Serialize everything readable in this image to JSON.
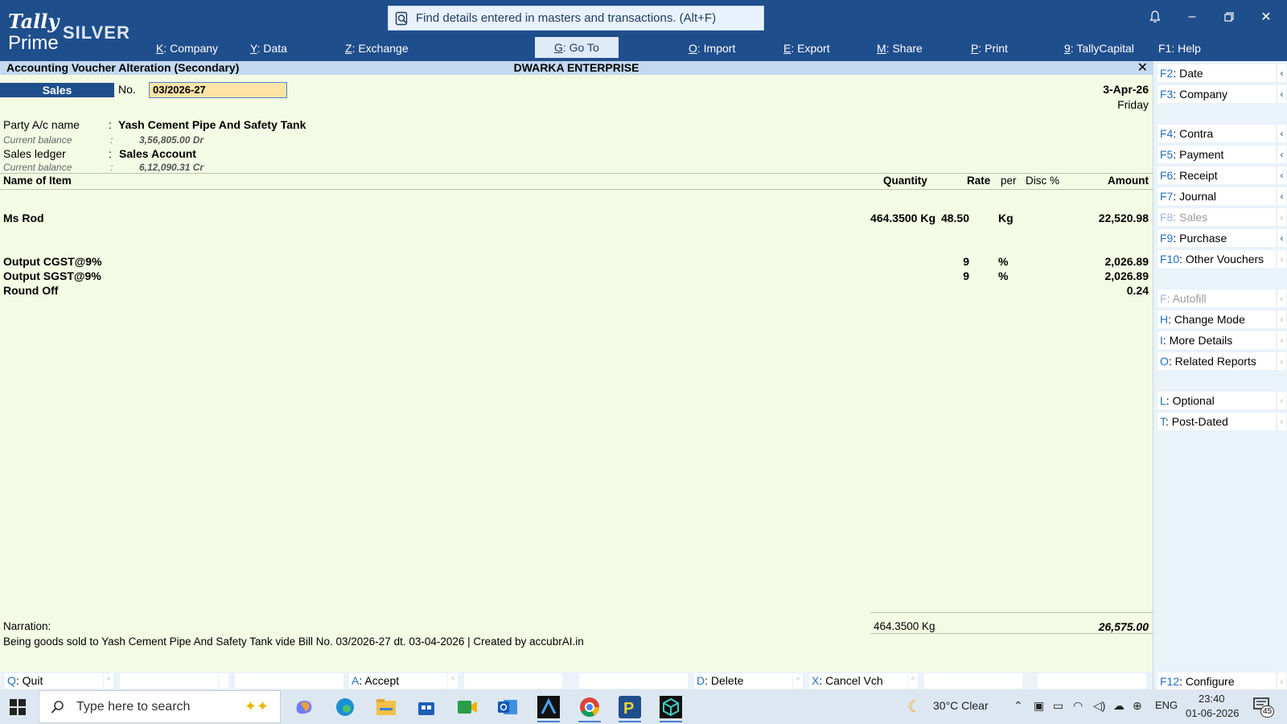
{
  "app": {
    "logo_line1": "Tally",
    "logo_line2": "Prime",
    "edition": "SILVER"
  },
  "search": {
    "text": "Find details entered in masters and transactions. (Alt+F)"
  },
  "menu": [
    {
      "key": "K",
      "label": "Company"
    },
    {
      "key": "Y",
      "label": "Data"
    },
    {
      "key": "Z",
      "label": "Exchange"
    },
    {
      "key": "G",
      "label": "Go To"
    },
    {
      "key": "O",
      "label": "Import"
    },
    {
      "key": "E",
      "label": "Export"
    },
    {
      "key": "M",
      "label": "Share"
    },
    {
      "key": "P",
      "label": "Print"
    },
    {
      "key": "9",
      "label": "TallyCapital"
    },
    {
      "key": "F1",
      "label": "Help"
    }
  ],
  "screen": {
    "title": "Accounting Voucher Alteration (Secondary)",
    "company": "DWARKA ENTERPRISE",
    "close": "✕"
  },
  "voucher": {
    "type": "Sales",
    "no_label": "No.",
    "number": "03/2026-27",
    "date": "3-Apr-26",
    "day": "Friday",
    "party_label": "Party A/c name",
    "party_name": "Yash Cement Pipe And Safety Tank",
    "party_balance_label": "Current balance",
    "party_balance": "3,56,805.00 Dr",
    "ledger_label": "Sales ledger",
    "ledger_name": "Sales Account",
    "ledger_balance_label": "Current balance",
    "ledger_balance": "6,12,090.31 Cr",
    "colon": ":"
  },
  "columns": {
    "item": "Name of Item",
    "quantity": "Quantity",
    "rate": "Rate",
    "per": "per",
    "disc": "Disc %",
    "amount": "Amount"
  },
  "items": [
    {
      "name": "Ms Rod",
      "quantity": "464.3500 Kg",
      "rate": "48.50",
      "per": "Kg",
      "amount": "22,520.98"
    }
  ],
  "ledgers": [
    {
      "name": "Output CGST@9%",
      "rate": "9",
      "per": "%",
      "amount": "2,026.89"
    },
    {
      "name": "Output SGST@9%",
      "rate": "9",
      "per": "%",
      "amount": "2,026.89"
    },
    {
      "name": "Round Off",
      "rate": "",
      "per": "",
      "amount": "0.24"
    }
  ],
  "footer": {
    "narration_label": "Narration:",
    "narration": "Being goods sold to Yash Cement Pipe And Safety Tank vide Bill No. 03/2026-27 dt. 03-04-2026 | Created by accubrAI.in",
    "total_qty": "464.3500 Kg",
    "total_amount": "26,575.00"
  },
  "right_panel": [
    {
      "key": "F2",
      "label": "Date",
      "enabled": true
    },
    {
      "key": "F3",
      "label": "Company",
      "enabled": true
    },
    {
      "key": "F4",
      "label": "Contra",
      "enabled": true
    },
    {
      "key": "F5",
      "label": "Payment",
      "enabled": true
    },
    {
      "key": "F6",
      "label": "Receipt",
      "enabled": true
    },
    {
      "key": "F7",
      "label": "Journal",
      "enabled": true
    },
    {
      "key": "F8",
      "label": "Sales",
      "enabled": false
    },
    {
      "key": "F9",
      "label": "Purchase",
      "enabled": true
    },
    {
      "key": "F10",
      "label": "Other Vouchers",
      "enabled": true
    },
    {
      "key": "F",
      "label": "Autofill",
      "enabled": false
    },
    {
      "key": "H",
      "label": "Change Mode",
      "enabled": true
    },
    {
      "key": "I",
      "label": "More Details",
      "enabled": true
    },
    {
      "key": "O",
      "label": "Related Reports",
      "enabled": true
    },
    {
      "key": "L",
      "label": "Optional",
      "enabled": true
    },
    {
      "key": "T",
      "label": "Post-Dated",
      "enabled": true
    },
    {
      "key": "F12",
      "label": "Configure",
      "enabled": true
    }
  ],
  "action_bar": [
    {
      "key": "Q",
      "label": "Quit"
    },
    {
      "key": "A",
      "label": "Accept"
    },
    {
      "key": "D",
      "label": "Delete"
    },
    {
      "key": "X",
      "label": "Cancel Vch"
    }
  ],
  "taskbar": {
    "search_placeholder": "Type here to search",
    "weather": "30°C  Clear",
    "language": "ENG",
    "time": "23:40",
    "date": "01-06-2026",
    "notifications": "45",
    "apps": [
      "copilot-icon",
      "edge-icon",
      "file-explorer-icon",
      "store-icon",
      "meet-icon",
      "outlook-icon",
      "app-a-icon",
      "chrome-icon",
      "p-app-icon",
      "cube-app-icon"
    ]
  },
  "colors": {
    "header_bg": "#1f4e8c",
    "main_bg": "#f3fbe4",
    "voucher_no_bg": "#fde4a6",
    "title_bar_bg": "#c3d9f0",
    "key_color": "#1f6fc5"
  }
}
